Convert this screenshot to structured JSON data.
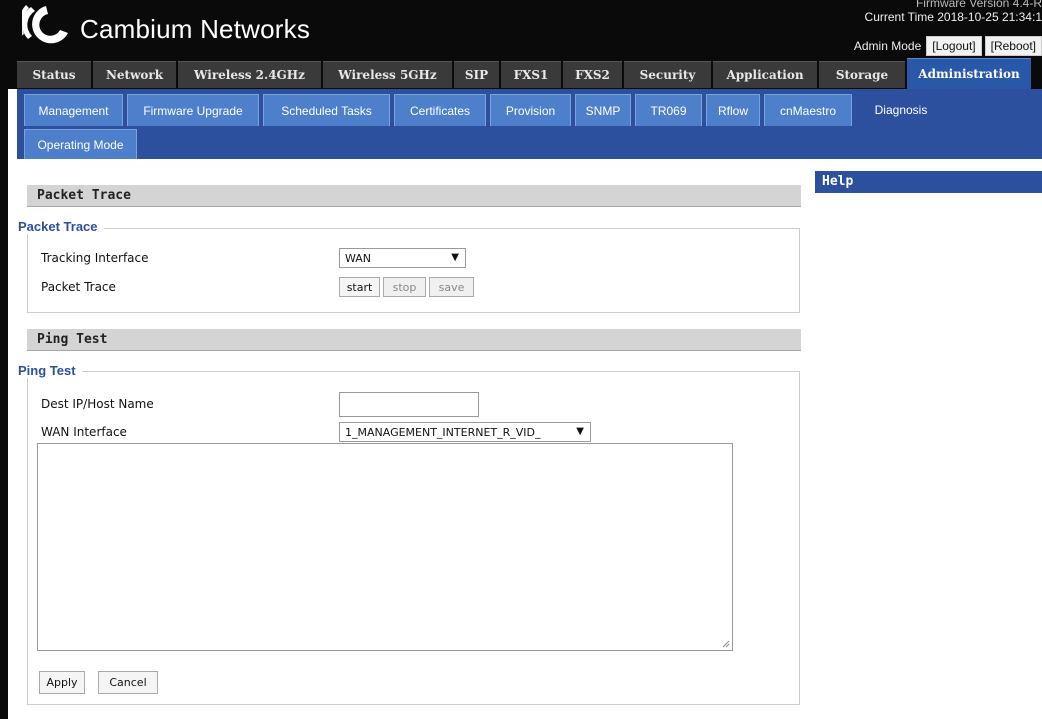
{
  "header": {
    "brand": "Cambium Networks",
    "firmware": "Firmware Version 4.4-R",
    "current_time": "Current Time 2018-10-25 21:34:1",
    "admin_mode": "Admin Mode",
    "logout": "[Logout]",
    "reboot": "[Reboot]"
  },
  "top_tabs": [
    "Status",
    "Network",
    "Wireless 2.4GHz",
    "Wireless 5GHz",
    "SIP",
    "FXS1",
    "FXS2",
    "Security",
    "Application",
    "Storage",
    "Administration"
  ],
  "top_tabs_active": "Administration",
  "sub_tabs": [
    "Management",
    "Firmware Upgrade",
    "Scheduled Tasks",
    "Certificates",
    "Provision",
    "SNMP",
    "TR069",
    "Rflow",
    "cnMaestro",
    "Diagnosis",
    "Operating Mode"
  ],
  "sub_tabs_active": "Diagnosis",
  "packet_trace": {
    "section_title": "Packet Trace",
    "legend": "Packet Trace",
    "tracking_label": "Tracking Interface",
    "tracking_value": "WAN",
    "trace_label": "Packet Trace",
    "start": "start",
    "stop": "stop",
    "save": "save"
  },
  "ping_test": {
    "section_title": "Ping Test",
    "legend": "Ping Test",
    "dest_label": "Dest IP/Host Name",
    "dest_value": "",
    "wan_label": "WAN Interface",
    "wan_value": "1_MANAGEMENT_INTERNET_R_VID_",
    "output": "",
    "apply": "Apply",
    "cancel": "Cancel"
  },
  "help": {
    "title": "Help"
  },
  "colors": {
    "accent": "#2c4f9e",
    "tab_light": "#4d7fcb",
    "header_bg": "#0a0a0a"
  },
  "icons": {
    "logo": "cambium-logo",
    "dropdown": "triangle-down-icon",
    "resize": "resize-grip-icon"
  }
}
